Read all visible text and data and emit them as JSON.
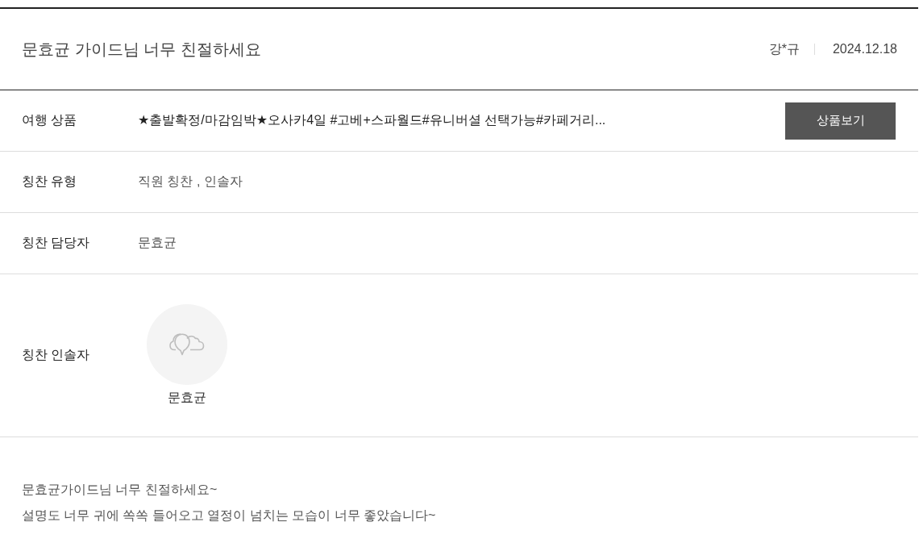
{
  "post": {
    "title": "문효균 가이드님 너무 친절하세요",
    "author": "강*규",
    "date": "2024.12.18"
  },
  "fields": [
    {
      "kind": "product",
      "label": "여행 상품",
      "value": "★출발확정/마감임박★오사카4일 #고베+스파월드#유니버셜 선택가능#카페거리...",
      "button": "상품보기"
    },
    {
      "kind": "text",
      "label": "칭찬 유형",
      "value": "직원 칭찬 , 인솔자"
    },
    {
      "kind": "text",
      "label": "칭찬 담당자",
      "value": "문효균"
    },
    {
      "kind": "people",
      "label": "칭찬 인솔자",
      "people": [
        {
          "name": "문효균"
        }
      ]
    }
  ],
  "body": [
    "문효균가이드님 너무 친절하세요~",
    "설명도 너무 귀에 쏙쏙 들어오고 열정이 넘치는 모습이 너무 좋았습니다~"
  ]
}
